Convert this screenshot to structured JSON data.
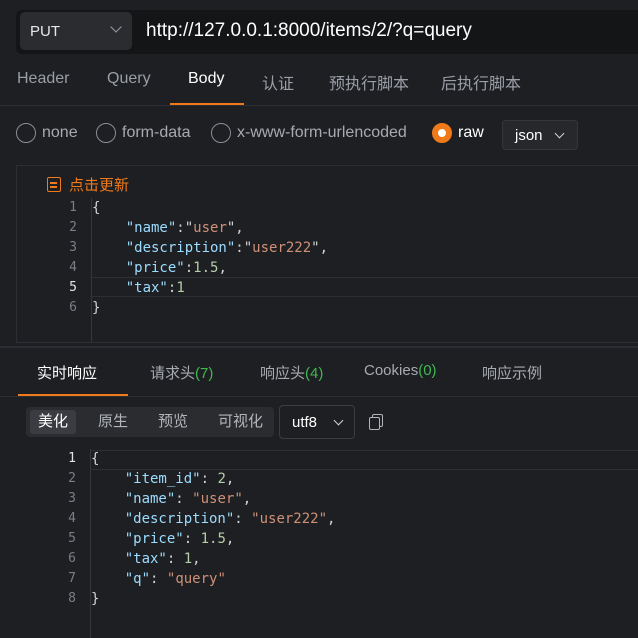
{
  "request": {
    "method": "PUT",
    "url": "http://127.0.0.1:8000/items/2/?q=query"
  },
  "req_tabs": [
    "Header",
    "Query",
    "Body",
    "认证",
    "预执行脚本",
    "后执行脚本"
  ],
  "req_active_tab": "Body",
  "body_types": [
    "none",
    "form-data",
    "x-www-form-urlencoded",
    "raw"
  ],
  "body_type_selected": "raw",
  "raw_format": "json",
  "update_label": "点击更新",
  "req_lines": [
    "1",
    "2",
    "3",
    "4",
    "5",
    "6"
  ],
  "req_body": {
    "name": "user",
    "description": "user222",
    "price": "1.5",
    "tax": "1"
  },
  "resp_tabs": {
    "realtime": "实时响应",
    "req_headers": "请求头",
    "req_headers_count": "(7)",
    "resp_headers": "响应头",
    "resp_headers_count": "(4)",
    "cookies": "Cookies",
    "cookies_count": "(0)",
    "example": "响应示例"
  },
  "view_modes": [
    "美化",
    "原生",
    "预览",
    "可视化"
  ],
  "view_active": "美化",
  "encoding": "utf8",
  "resp_lines": [
    "1",
    "2",
    "3",
    "4",
    "5",
    "6",
    "7",
    "8"
  ],
  "resp_body": {
    "item_id": "2",
    "name": "user",
    "description": "user222",
    "price": "1.5",
    "tax": "1",
    "q": "query"
  },
  "colors": {
    "accent": "#f07a1a",
    "count_green": "#3fb950",
    "bg": "#1e1f22"
  }
}
